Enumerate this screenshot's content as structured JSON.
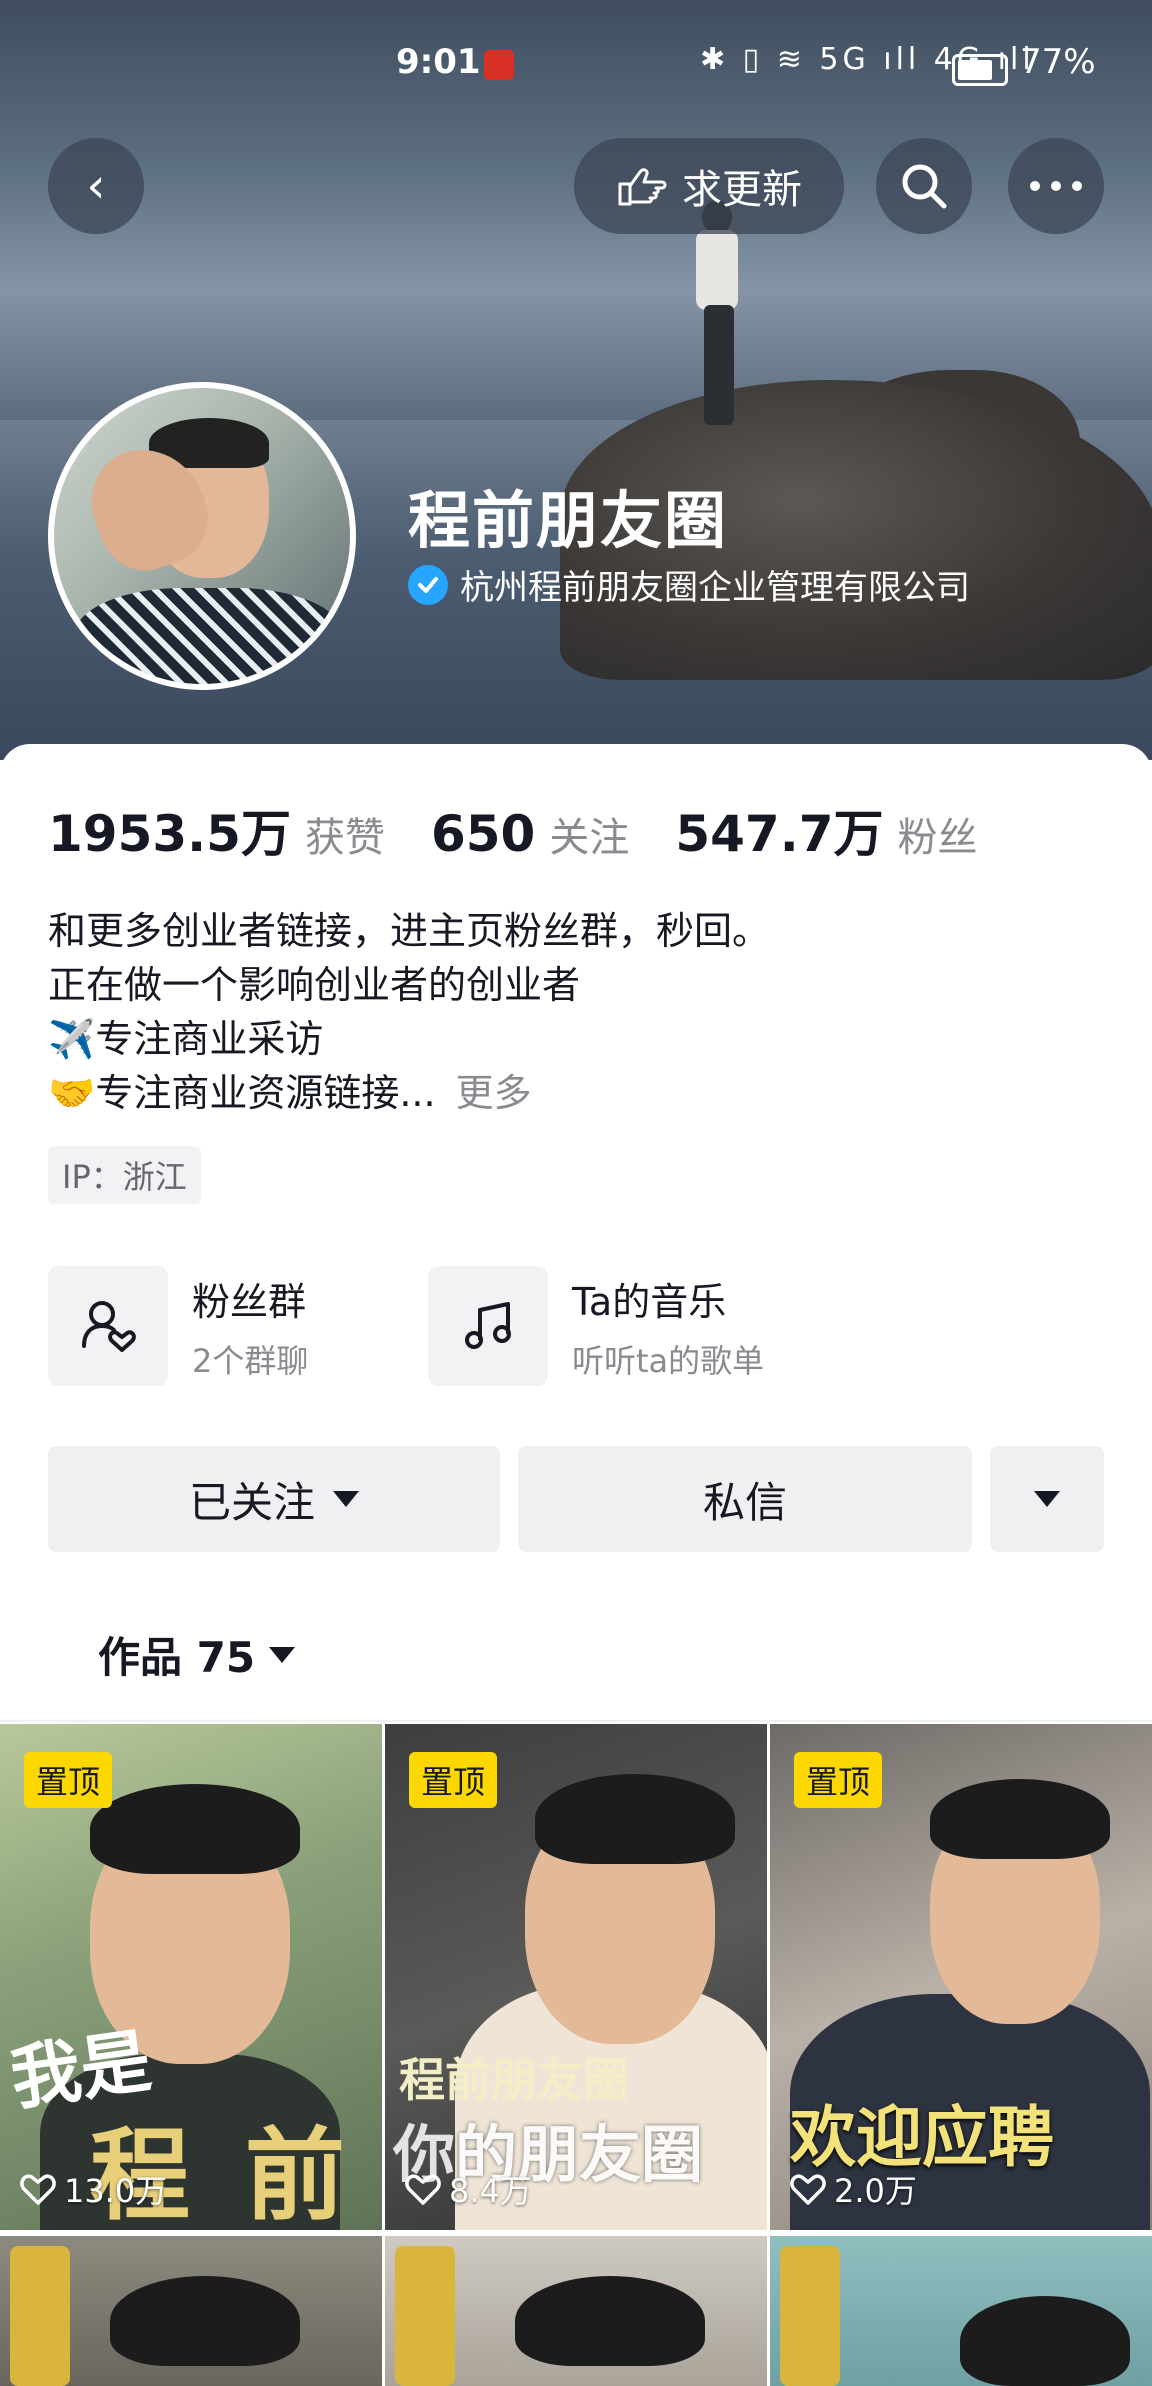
{
  "status_bar": {
    "time": "9:01",
    "icons": "✱ ▯ ≋ 5G ıll 4G ıll",
    "battery": "77%"
  },
  "header": {
    "back_icon": "‹",
    "update_label": "求更新",
    "name": "程前朋友圈",
    "verification": "杭州程前朋友圈企业管理有限公司"
  },
  "stats": [
    {
      "value": "1953.5万",
      "label": "获赞"
    },
    {
      "value": "650",
      "label": "关注"
    },
    {
      "value": "547.7万",
      "label": "粉丝"
    }
  ],
  "bio": {
    "line1": "和更多创业者链接，进主页粉丝群，秒回。",
    "line2": "正在做一个影响创业者的创业者",
    "line3": "✈️专注商业采访",
    "line4": "🤝专注商业资源链接...",
    "more": "更多"
  },
  "ip": "IP：浙江",
  "entries": {
    "fans_group": {
      "title": "粉丝群",
      "subtitle": "2个群聊"
    },
    "music": {
      "title": "Ta的音乐",
      "subtitle": "听听ta的歌单"
    }
  },
  "actions": {
    "following": "已关注",
    "message": "私信"
  },
  "works_tab": "作品 75",
  "videos": [
    {
      "pin": "置顶",
      "likes": "13.0万",
      "caption_a": "我是",
      "caption_b": "程 前"
    },
    {
      "pin": "置顶",
      "likes": "8.4万",
      "caption_a": "程前朋友圈",
      "caption_b": "你的朋友圈"
    },
    {
      "pin": "置顶",
      "likes": "2.0万",
      "caption_a": "欢迎应聘",
      "caption_b": ""
    }
  ],
  "colors": {
    "accent_pin": "#fdd700",
    "verify_blue": "#27a6ff",
    "text": "#161823",
    "muted": "#8a8b91"
  }
}
